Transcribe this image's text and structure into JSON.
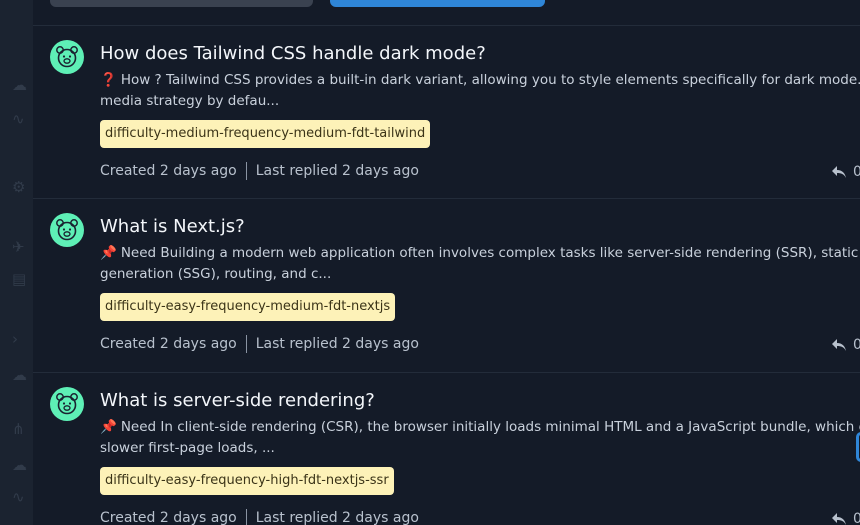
{
  "sidebar": {
    "icons": [
      "cloud-icon",
      "chart-icon",
      "gear-icon",
      "pin-icon",
      "table-icon",
      "code-icon",
      "cloud-icon",
      "network-icon",
      "chart-icon"
    ]
  },
  "colors": {
    "accent": "#2f86d8",
    "avatar": "#5ef0b6",
    "tag_bg": "#fdf2b8",
    "question_mark": "#e2483e"
  },
  "posts": [
    {
      "title": "How does Tailwind CSS handle dark mode?",
      "marker": "❓",
      "excerpt_line1": "How ? Tailwind CSS provides a built-in dark variant, allowing you to style elements specifically for dark mode. It",
      "excerpt_line2": "media strategy by defau...",
      "tag": "difficulty-medium-frequency-medium-fdt-tailwind",
      "created": "Created 2 days ago",
      "last_replied": "Last replied 2 days ago",
      "reply_count": "0"
    },
    {
      "title": "What is Next.js?",
      "marker": "📌",
      "excerpt_line1": "Need Building a modern web application often involves complex tasks like server-side rendering (SSR), static site",
      "excerpt_line2": "generation (SSG), routing, and c...",
      "tag": "difficulty-easy-frequency-medium-fdt-nextjs",
      "created": "Created 2 days ago",
      "last_replied": "Last replied 2 days ago",
      "reply_count": "0"
    },
    {
      "title": "What is server-side rendering?",
      "marker": "📌",
      "excerpt_line1": "Need In client-side rendering (CSR), the browser initially loads minimal HTML and a JavaScript bundle, which can",
      "excerpt_line2": "slower first-page loads, ...",
      "tag": "difficulty-easy-frequency-high-fdt-nextjs-ssr",
      "created": "Created 2 days ago",
      "last_replied": "Last replied 2 days ago",
      "reply_count": "0"
    }
  ]
}
